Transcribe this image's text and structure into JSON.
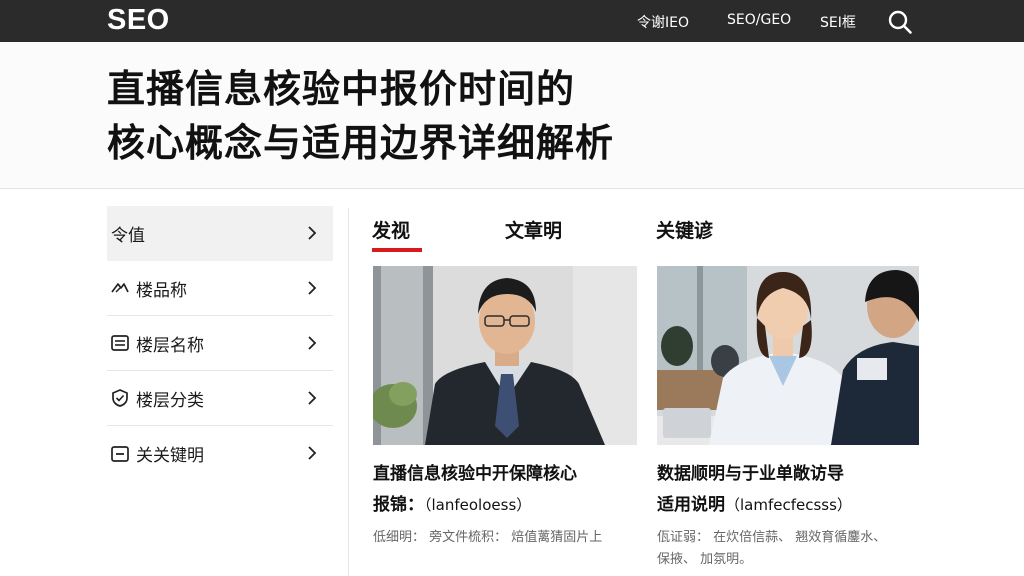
{
  "header": {
    "logo": "SEO",
    "nav": [
      "令谢IEO",
      "SEO/GEO",
      "SEI框"
    ],
    "search_icon": "search-icon"
  },
  "hero": {
    "title_line1": "直播信息核验中报价时间的",
    "title_line2": "核心概念与适用边界详细解析"
  },
  "sidebar": {
    "items": [
      {
        "label": "令值",
        "icon": "",
        "active": true
      },
      {
        "label": "楼品称",
        "icon": "sparkle-icon"
      },
      {
        "label": "楼层名称",
        "icon": "list-icon"
      },
      {
        "label": "楼层分类",
        "icon": "shield-icon"
      },
      {
        "label": "关关键明",
        "icon": "card-icon"
      }
    ]
  },
  "tabs": {
    "items": [
      "发视",
      "文章明",
      "关键谚"
    ],
    "active_color": "#d91a1a"
  },
  "cards": [
    {
      "title_line1": "直播信息核验中开保障核心",
      "title_line2_main": "报锦：",
      "title_line2_sub": "（lanfeoloess）",
      "meta": "低细明：  旁文件梳积：  焙值蓠猜固片上",
      "image": "man-in-suit-photo"
    },
    {
      "title_line1": "数据顺明与于业单敞访导",
      "title_line2_main": "适用说明",
      "title_line2_sub": "（lamfecfecsss）",
      "meta": "佤证弱：  在炊倍信蒜、  翘效育循鏖水、",
      "meta_line2": "保掖、  加氛明。",
      "image": "woman-meeting-photo"
    }
  ],
  "colors": {
    "topbar": "#2b2b2b",
    "accent": "#d91a1a"
  }
}
